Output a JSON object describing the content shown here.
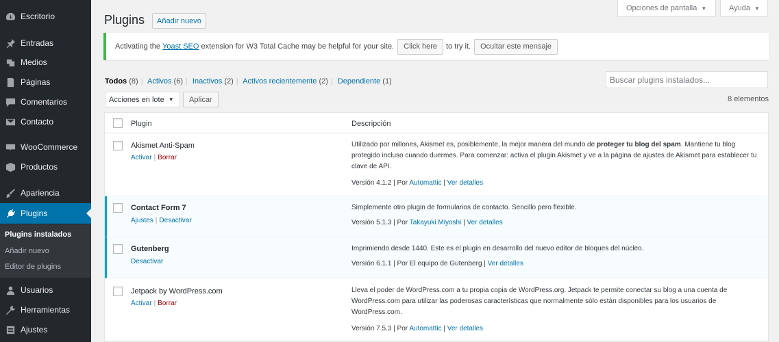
{
  "sidebar": {
    "items": [
      {
        "label": "Escritorio",
        "icon": "dashboard-icon"
      },
      {
        "label": "Entradas",
        "icon": "pin-icon"
      },
      {
        "label": "Medios",
        "icon": "media-icon"
      },
      {
        "label": "Páginas",
        "icon": "pages-icon"
      },
      {
        "label": "Comentarios",
        "icon": "comments-icon"
      },
      {
        "label": "Contacto",
        "icon": "mail-icon"
      },
      {
        "label": "WooCommerce",
        "icon": "woocommerce-icon"
      },
      {
        "label": "Productos",
        "icon": "box-icon"
      },
      {
        "label": "Apariencia",
        "icon": "brush-icon"
      },
      {
        "label": "Plugins",
        "icon": "plug-icon"
      },
      {
        "label": "Usuarios",
        "icon": "users-icon"
      },
      {
        "label": "Herramientas",
        "icon": "wrench-icon"
      },
      {
        "label": "Ajustes",
        "icon": "settings-icon"
      }
    ],
    "submenu": [
      "Plugins instalados",
      "Añadir nuevo",
      "Editor de plugins"
    ]
  },
  "top": {
    "screen_options": "Opciones de pantalla",
    "help": "Ayuda"
  },
  "page": {
    "title": "Plugins",
    "add_new": "Añadir nuevo"
  },
  "notice": {
    "pre": "Activating the",
    "link": "Yoast SEO",
    "mid": "extension for W3 Total Cache may be helpful for your site.",
    "btn": "Click here",
    "post": "to try it.",
    "dismiss": "Ocultar este mensaje"
  },
  "filters": {
    "all": "Todos",
    "all_count": "(8)",
    "active": "Activos",
    "active_count": "(6)",
    "inactive": "Inactivos",
    "inactive_count": "(2)",
    "recent": "Activos recientemente",
    "recent_count": "(2)",
    "dependent": "Dependiente",
    "dependent_count": "(1)"
  },
  "search": {
    "placeholder": "Buscar plugins instalados..."
  },
  "bulk": {
    "label": "Acciones en lote",
    "apply": "Aplicar",
    "count": "8 elementos"
  },
  "table": {
    "col_plugin": "Plugin",
    "col_desc": "Descripción",
    "rows": [
      {
        "name": "Akismet Anti-Spam",
        "action1": "Activar",
        "action2": "Borrar",
        "desc_pre": "Utilizado por millones, Akismet es, posiblemente, la mejor manera del mundo de ",
        "desc_bold": "proteger tu blog del spam",
        "desc_post": ". Mantiene tu blog protegido incluso cuando duermes. Para comenzar: activa el plugin Akismet y ve a la página de ajustes de Akismet para establecer tu clave de API.",
        "version": "Versión 4.1.2",
        "by": "Por",
        "author": "Automattic",
        "details": "Ver detalles"
      },
      {
        "name": "Contact Form 7",
        "action1": "Ajustes",
        "action2": "Desactivar",
        "desc": "Simplemente otro plugin de formularios de contacto. Sencillo pero flexible.",
        "version": "Versión 5.1.3",
        "by": "Por",
        "author": "Takayuki Miyoshi",
        "details": "Ver detalles"
      },
      {
        "name": "Gutenberg",
        "action1": "Desactivar",
        "desc": "Imprimiendo desde 1440. Este es el plugin en desarrollo del nuevo editor de bloques del núcleo.",
        "version": "Versión 6.1.1",
        "by_author": "Por El equipo de Gutenberg",
        "details": "Ver detalles"
      },
      {
        "name": "Jetpack by WordPress.com",
        "action1": "Activar",
        "action2": "Borrar",
        "desc": "Lleva el poder de WordPress.com a tu propia copia de WordPress.org. Jetpack te permite conectar su blog a una cuenta de WordPress.com para utilizar las poderosas características que normalmente sólo están disponibles para los usuarios de WordPress.com.",
        "version": "Versión 7.5.3",
        "by": "Por",
        "author": "Automattic",
        "details": "Ver detalles"
      }
    ]
  }
}
